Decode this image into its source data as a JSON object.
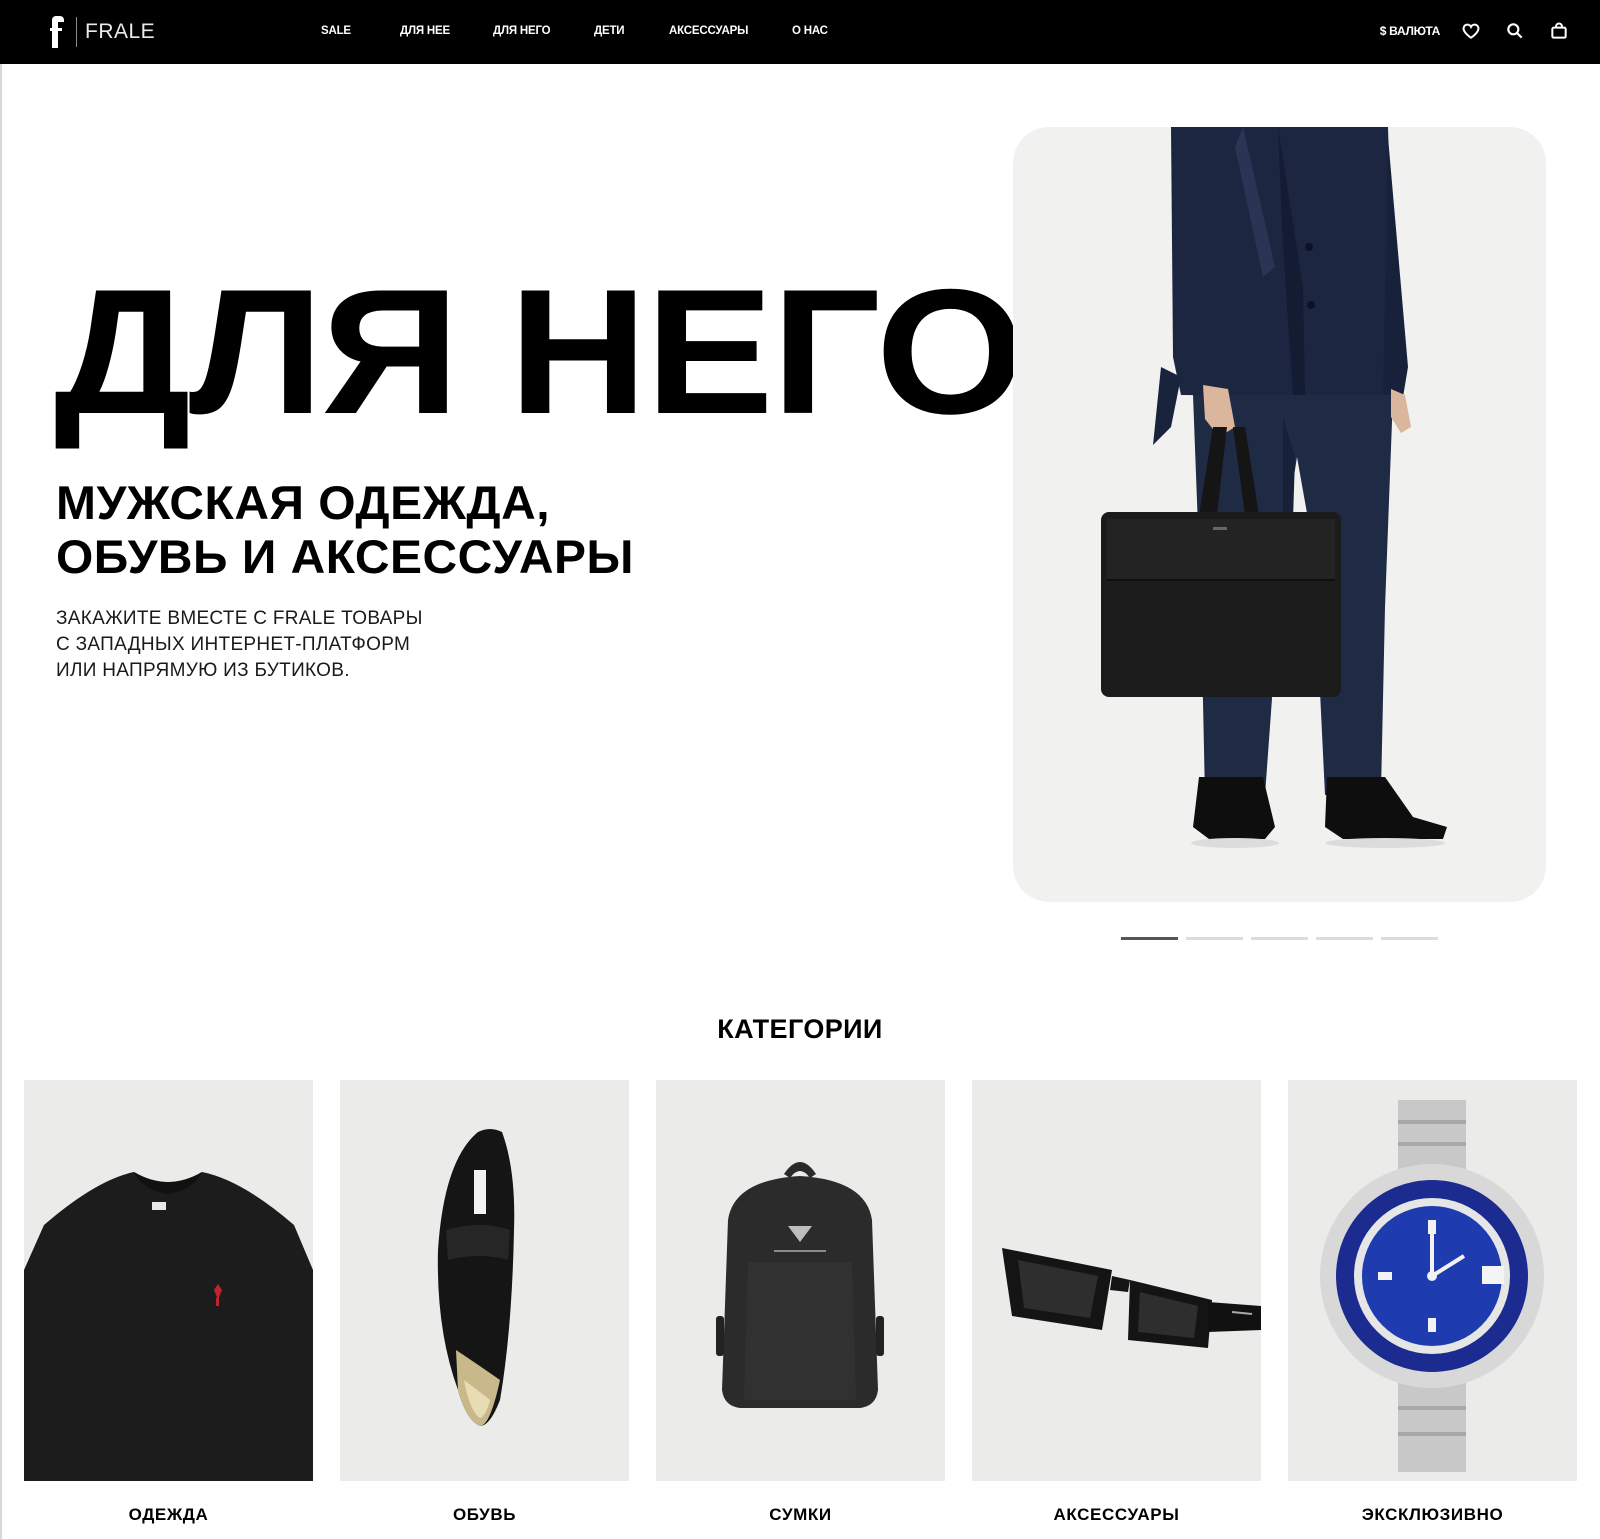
{
  "header": {
    "logo_text": "FRALE",
    "nav": [
      {
        "label": "SALE"
      },
      {
        "label": "ДЛЯ НЕЕ"
      },
      {
        "label": "ДЛЯ НЕГО"
      },
      {
        "label": "ДЕТИ"
      },
      {
        "label": "АКСЕССУАРЫ"
      },
      {
        "label": "О НАС"
      }
    ],
    "currency_label": "$ ВАЛЮТА",
    "icons": [
      "heart-icon",
      "search-icon",
      "bag-icon"
    ]
  },
  "hero": {
    "title": "ДЛЯ НЕГО",
    "subtitle_line1": "МУЖСКАЯ ОДЕЖДА,",
    "subtitle_line2": "ОБУВЬ И АКСЕССУАРЫ",
    "desc_line1": "ЗАКАЖИТЕ ВМЕСТЕ С FRALE ТОВАРЫ",
    "desc_line2": "С ЗАПАДНЫХ ИНТЕРНЕТ-ПЛАТФОРМ",
    "desc_line3": "ИЛИ НАПРЯМУЮ ИЗ БУТИКОВ.",
    "slider": {
      "count": 5,
      "active": 1
    }
  },
  "categories": {
    "title": "КАТЕГОРИИ",
    "items": [
      {
        "label": "ОДЕЖДА",
        "image": "sweater"
      },
      {
        "label": "ОБУВЬ",
        "image": "shoe"
      },
      {
        "label": "СУМКИ",
        "image": "backpack"
      },
      {
        "label": "АКСЕССУАРЫ",
        "image": "sunglasses"
      },
      {
        "label": "ЭКСКЛЮЗИВНО",
        "image": "watch"
      }
    ]
  },
  "colors": {
    "header_bg": "#000000",
    "card_bg": "#f1f1f0",
    "suit": "#1f2a44",
    "watch_dial": "#1f3bb0"
  }
}
